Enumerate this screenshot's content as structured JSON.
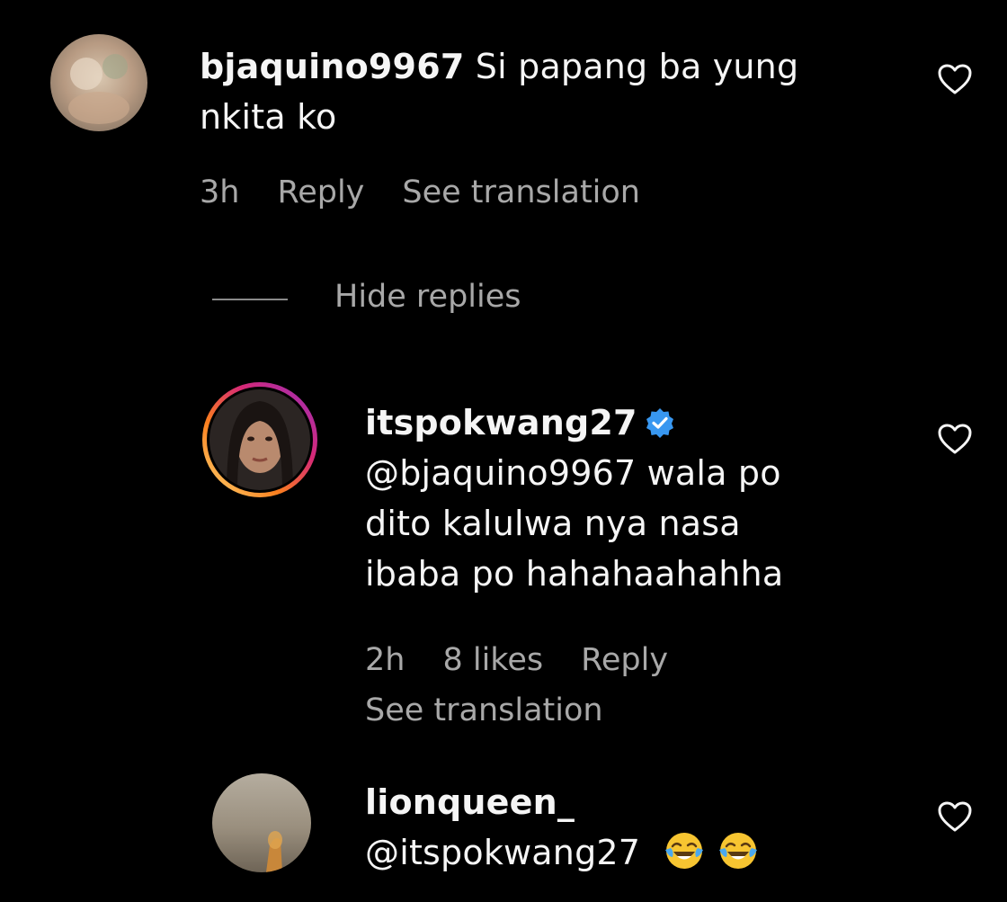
{
  "comments": [
    {
      "username": "bjaquino9967",
      "text_line1": " Si papang ba yung",
      "text_line2": "nkita ko",
      "time": "3h",
      "reply_label": "Reply",
      "see_translation": "See translation"
    }
  ],
  "hide_replies_label": "Hide replies",
  "replies": [
    {
      "username": "itspokwang27",
      "verified": true,
      "text_line1": "@bjaquino9967 wala po",
      "text_line2": "dito kalulwa nya nasa",
      "text_line3": "ibaba po hahahaahahha",
      "time": "2h",
      "likes": "8 likes",
      "reply_label": "Reply",
      "see_translation": "See translation"
    },
    {
      "username": "lionqueen_",
      "text": "@itspokwang27",
      "emojis": [
        "face-with-tears-of-joy-icon",
        "face-with-tears-of-joy-icon"
      ]
    }
  ],
  "colors": {
    "background": "#000000",
    "primary_text": "#f5f5f5",
    "secondary_text": "#a8a8a8",
    "verified_blue": "#3897f0"
  },
  "icons": {
    "like": "heart-outline-icon",
    "verified": "verified-badge-icon"
  }
}
